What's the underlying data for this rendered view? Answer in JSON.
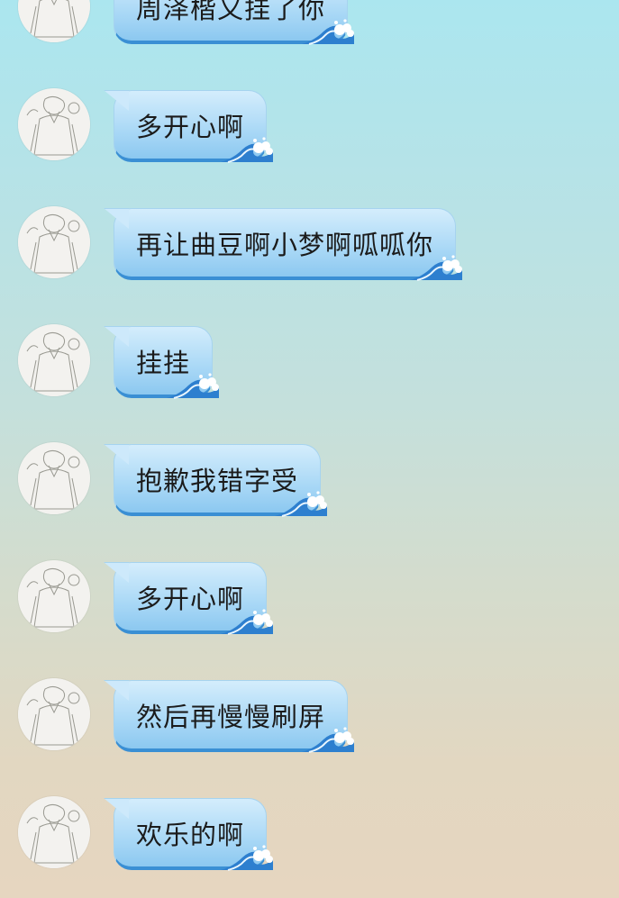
{
  "messages": [
    {
      "text": "周泽楷又挂了你"
    },
    {
      "text": "多开心啊"
    },
    {
      "text": "再让曲豆啊小梦啊呱呱你"
    },
    {
      "text": "挂挂"
    },
    {
      "text": "抱歉我错字受"
    },
    {
      "text": "多开心啊"
    },
    {
      "text": "然后再慢慢刷屏"
    },
    {
      "text": "欢乐的啊"
    }
  ],
  "colors": {
    "bubble_top": "#d4edfc",
    "bubble_bottom": "#8cc8f0",
    "bubble_border": "#3a8fd4",
    "text": "#1b1b1b"
  },
  "icons": {
    "avatar": "sketch-character-avatar",
    "bubble_decoration": "ocean-wave-icon"
  }
}
